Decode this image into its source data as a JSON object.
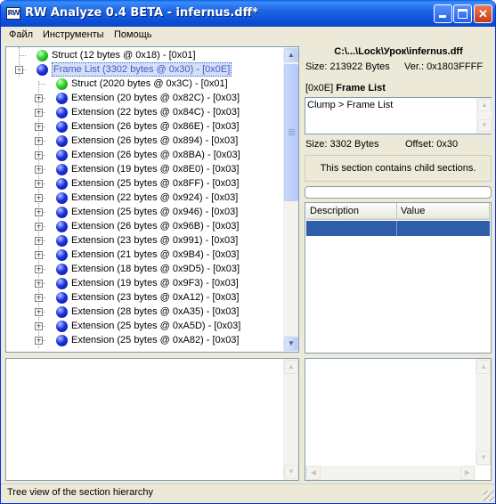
{
  "window": {
    "app_icon_text": "RW",
    "title": "RW Analyze 0.4 BETA - infernus.dff*"
  },
  "menu": [
    {
      "label": "Файл"
    },
    {
      "label": "Инструменты"
    },
    {
      "label": "Помощь"
    }
  ],
  "tree": {
    "rows": [
      {
        "text": "Struct  (12 bytes @ 0x18) - [0x01]",
        "dot": "green",
        "level": 0,
        "expander": "",
        "selected": false
      },
      {
        "text": "Frame List  (3302 bytes @ 0x30) - [0x0E]",
        "dot": "blue",
        "level": 0,
        "expander": "−",
        "selected": true
      },
      {
        "text": "Struct  (2020 bytes @ 0x3C) - [0x01]",
        "dot": "green",
        "level": 1,
        "expander": "",
        "selected": false
      },
      {
        "text": "Extension  (20 bytes @ 0x82C) - [0x03]",
        "dot": "blue",
        "level": 1,
        "expander": "+",
        "selected": false
      },
      {
        "text": "Extension  (22 bytes @ 0x84C) - [0x03]",
        "dot": "blue",
        "level": 1,
        "expander": "+",
        "selected": false
      },
      {
        "text": "Extension  (26 bytes @ 0x86E) - [0x03]",
        "dot": "blue",
        "level": 1,
        "expander": "+",
        "selected": false
      },
      {
        "text": "Extension  (26 bytes @ 0x894) - [0x03]",
        "dot": "blue",
        "level": 1,
        "expander": "+",
        "selected": false
      },
      {
        "text": "Extension  (26 bytes @ 0x8BA) - [0x03]",
        "dot": "blue",
        "level": 1,
        "expander": "+",
        "selected": false
      },
      {
        "text": "Extension  (19 bytes @ 0x8E0) - [0x03]",
        "dot": "blue",
        "level": 1,
        "expander": "+",
        "selected": false
      },
      {
        "text": "Extension  (25 bytes @ 0x8FF) - [0x03]",
        "dot": "blue",
        "level": 1,
        "expander": "+",
        "selected": false
      },
      {
        "text": "Extension  (22 bytes @ 0x924) - [0x03]",
        "dot": "blue",
        "level": 1,
        "expander": "+",
        "selected": false
      },
      {
        "text": "Extension  (25 bytes @ 0x946) - [0x03]",
        "dot": "blue",
        "level": 1,
        "expander": "+",
        "selected": false
      },
      {
        "text": "Extension  (26 bytes @ 0x96B) - [0x03]",
        "dot": "blue",
        "level": 1,
        "expander": "+",
        "selected": false
      },
      {
        "text": "Extension  (23 bytes @ 0x991) - [0x03]",
        "dot": "blue",
        "level": 1,
        "expander": "+",
        "selected": false
      },
      {
        "text": "Extension  (21 bytes @ 0x9B4) - [0x03]",
        "dot": "blue",
        "level": 1,
        "expander": "+",
        "selected": false
      },
      {
        "text": "Extension  (18 bytes @ 0x9D5) - [0x03]",
        "dot": "blue",
        "level": 1,
        "expander": "+",
        "selected": false
      },
      {
        "text": "Extension  (19 bytes @ 0x9F3) - [0x03]",
        "dot": "blue",
        "level": 1,
        "expander": "+",
        "selected": false
      },
      {
        "text": "Extension  (23 bytes @ 0xA12) - [0x03]",
        "dot": "blue",
        "level": 1,
        "expander": "+",
        "selected": false
      },
      {
        "text": "Extension  (28 bytes @ 0xA35) - [0x03]",
        "dot": "blue",
        "level": 1,
        "expander": "+",
        "selected": false
      },
      {
        "text": "Extension  (25 bytes @ 0xA5D) - [0x03]",
        "dot": "blue",
        "level": 1,
        "expander": "+",
        "selected": false
      },
      {
        "text": "Extension  (25 bytes @ 0xA82) - [0x03]",
        "dot": "blue",
        "level": 1,
        "expander": "+",
        "selected": false
      }
    ]
  },
  "info": {
    "file_path": "C:\\...\\Lock\\Урок\\infernus.dff",
    "file_size": "Size: 213922 Bytes",
    "version": "Ver.: 0x1803FFFF",
    "section_id": "[0x0E]",
    "section_name": "Frame List",
    "breadcrumb": "Clump > Frame List",
    "section_size": "Size: 3302 Bytes",
    "section_offset": "Offset: 0x30",
    "child_note": "This section contains child sections."
  },
  "properties": {
    "columns": [
      "Description",
      "Value"
    ]
  },
  "status": {
    "text": "Tree view of the section hierarchy"
  },
  "colors": {
    "selection": "#2f5ea8",
    "titlebar": "#0a4fd6"
  }
}
